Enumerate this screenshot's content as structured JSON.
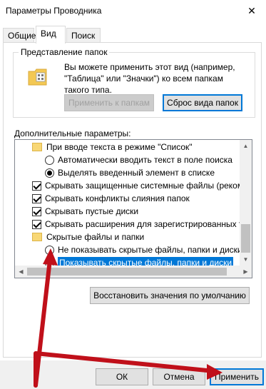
{
  "window": {
    "title": "Параметры Проводника",
    "close": "✕"
  },
  "tabs": [
    {
      "label": "Общие"
    },
    {
      "label": "Вид"
    },
    {
      "label": "Поиск"
    }
  ],
  "folder_views": {
    "legend": "Представление папок",
    "description": "Вы можете применить этот вид (например, \"Таблица\" или \"Значки\") ко всем папкам такого типа.",
    "apply_button": "Применить к папкам",
    "reset_button": "Сброс вида папок"
  },
  "advanced": {
    "label": "Дополнительные параметры:",
    "items": [
      {
        "type": "folder",
        "text": "При вводе текста в режиме \"Список\""
      },
      {
        "type": "radio",
        "checked": false,
        "text": "Автоматически вводить текст в поле поиска"
      },
      {
        "type": "radio",
        "checked": true,
        "text": "Выделять введенный элемент в списке"
      },
      {
        "type": "checkbox",
        "checked": true,
        "text": "Скрывать защищенные системные файлы (рекомен"
      },
      {
        "type": "checkbox",
        "checked": true,
        "text": "Скрывать конфликты слияния папок"
      },
      {
        "type": "checkbox",
        "checked": true,
        "text": "Скрывать пустые диски"
      },
      {
        "type": "checkbox",
        "checked": true,
        "text": "Скрывать расширения для зарегистрированных типо"
      },
      {
        "type": "folder",
        "text": "Скрытые файлы и папки"
      },
      {
        "type": "radio",
        "checked": false,
        "text": "Не показывать скрытые файлы, папки и диски"
      },
      {
        "type": "radio",
        "checked": true,
        "text": "Показывать скрытые файлы, папки и диски"
      }
    ],
    "restore_button": "Восстановить значения по умолчанию"
  },
  "footer": {
    "ok": "ОК",
    "cancel": "Отмена",
    "apply": "Применить"
  },
  "colors": {
    "selection": "#0078d7",
    "annotation_arrow": "#c0101a"
  }
}
